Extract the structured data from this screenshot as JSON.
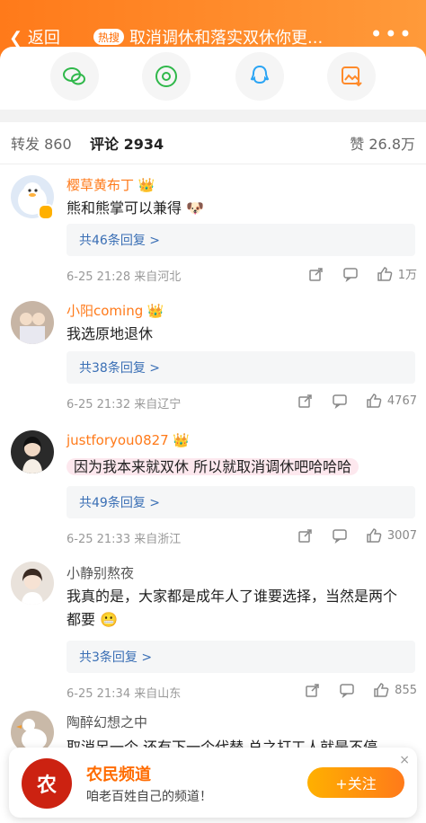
{
  "topbar": {
    "back_label": "返回",
    "hot_badge": "热搜",
    "title": "取消调休和落实双休你更...",
    "more_label": "•••"
  },
  "share": [
    "wechat-icon",
    "moments-icon",
    "qq-icon",
    "image-save-icon"
  ],
  "tabs": {
    "repost": "转发 860",
    "comment": "评论 2934",
    "like": "赞 26.8万"
  },
  "comments": [
    {
      "name": "樱草黄布丁",
      "text": "熊和熊掌可以兼得",
      "emoji": "🐶",
      "replies": "共46条回复 >",
      "meta": "6-25 21:28  来自河北",
      "likes": "1万"
    },
    {
      "name": "小阳coming",
      "text": "我选原地退休",
      "replies": "共38条回复 >",
      "meta": "6-25 21:32  来自辽宁",
      "likes": "4767"
    },
    {
      "name": "justforyou0827",
      "text": "因为我本来就双休 所以就取消调休吧哈哈哈",
      "replies": "共49条回复 >",
      "meta": "6-25 21:33  来自浙江",
      "likes": "3007"
    },
    {
      "name": "小静别熬夜",
      "text": "我真的是，大家都是成年人了谁要选择，当然是两个都要",
      "emoji": "😬",
      "replies": "共3条回复 >",
      "meta": "6-25 21:34  来自山东",
      "likes": "855"
    },
    {
      "name": "陶醉幻想之中",
      "text": "取消另一个 还有下一个代替 总之打工人就是不停"
    }
  ],
  "promo": {
    "logo_text": "农",
    "title": "农民频道",
    "subtitle": "咱老百姓自己的频道！",
    "follow": "+关注",
    "close": "×"
  }
}
